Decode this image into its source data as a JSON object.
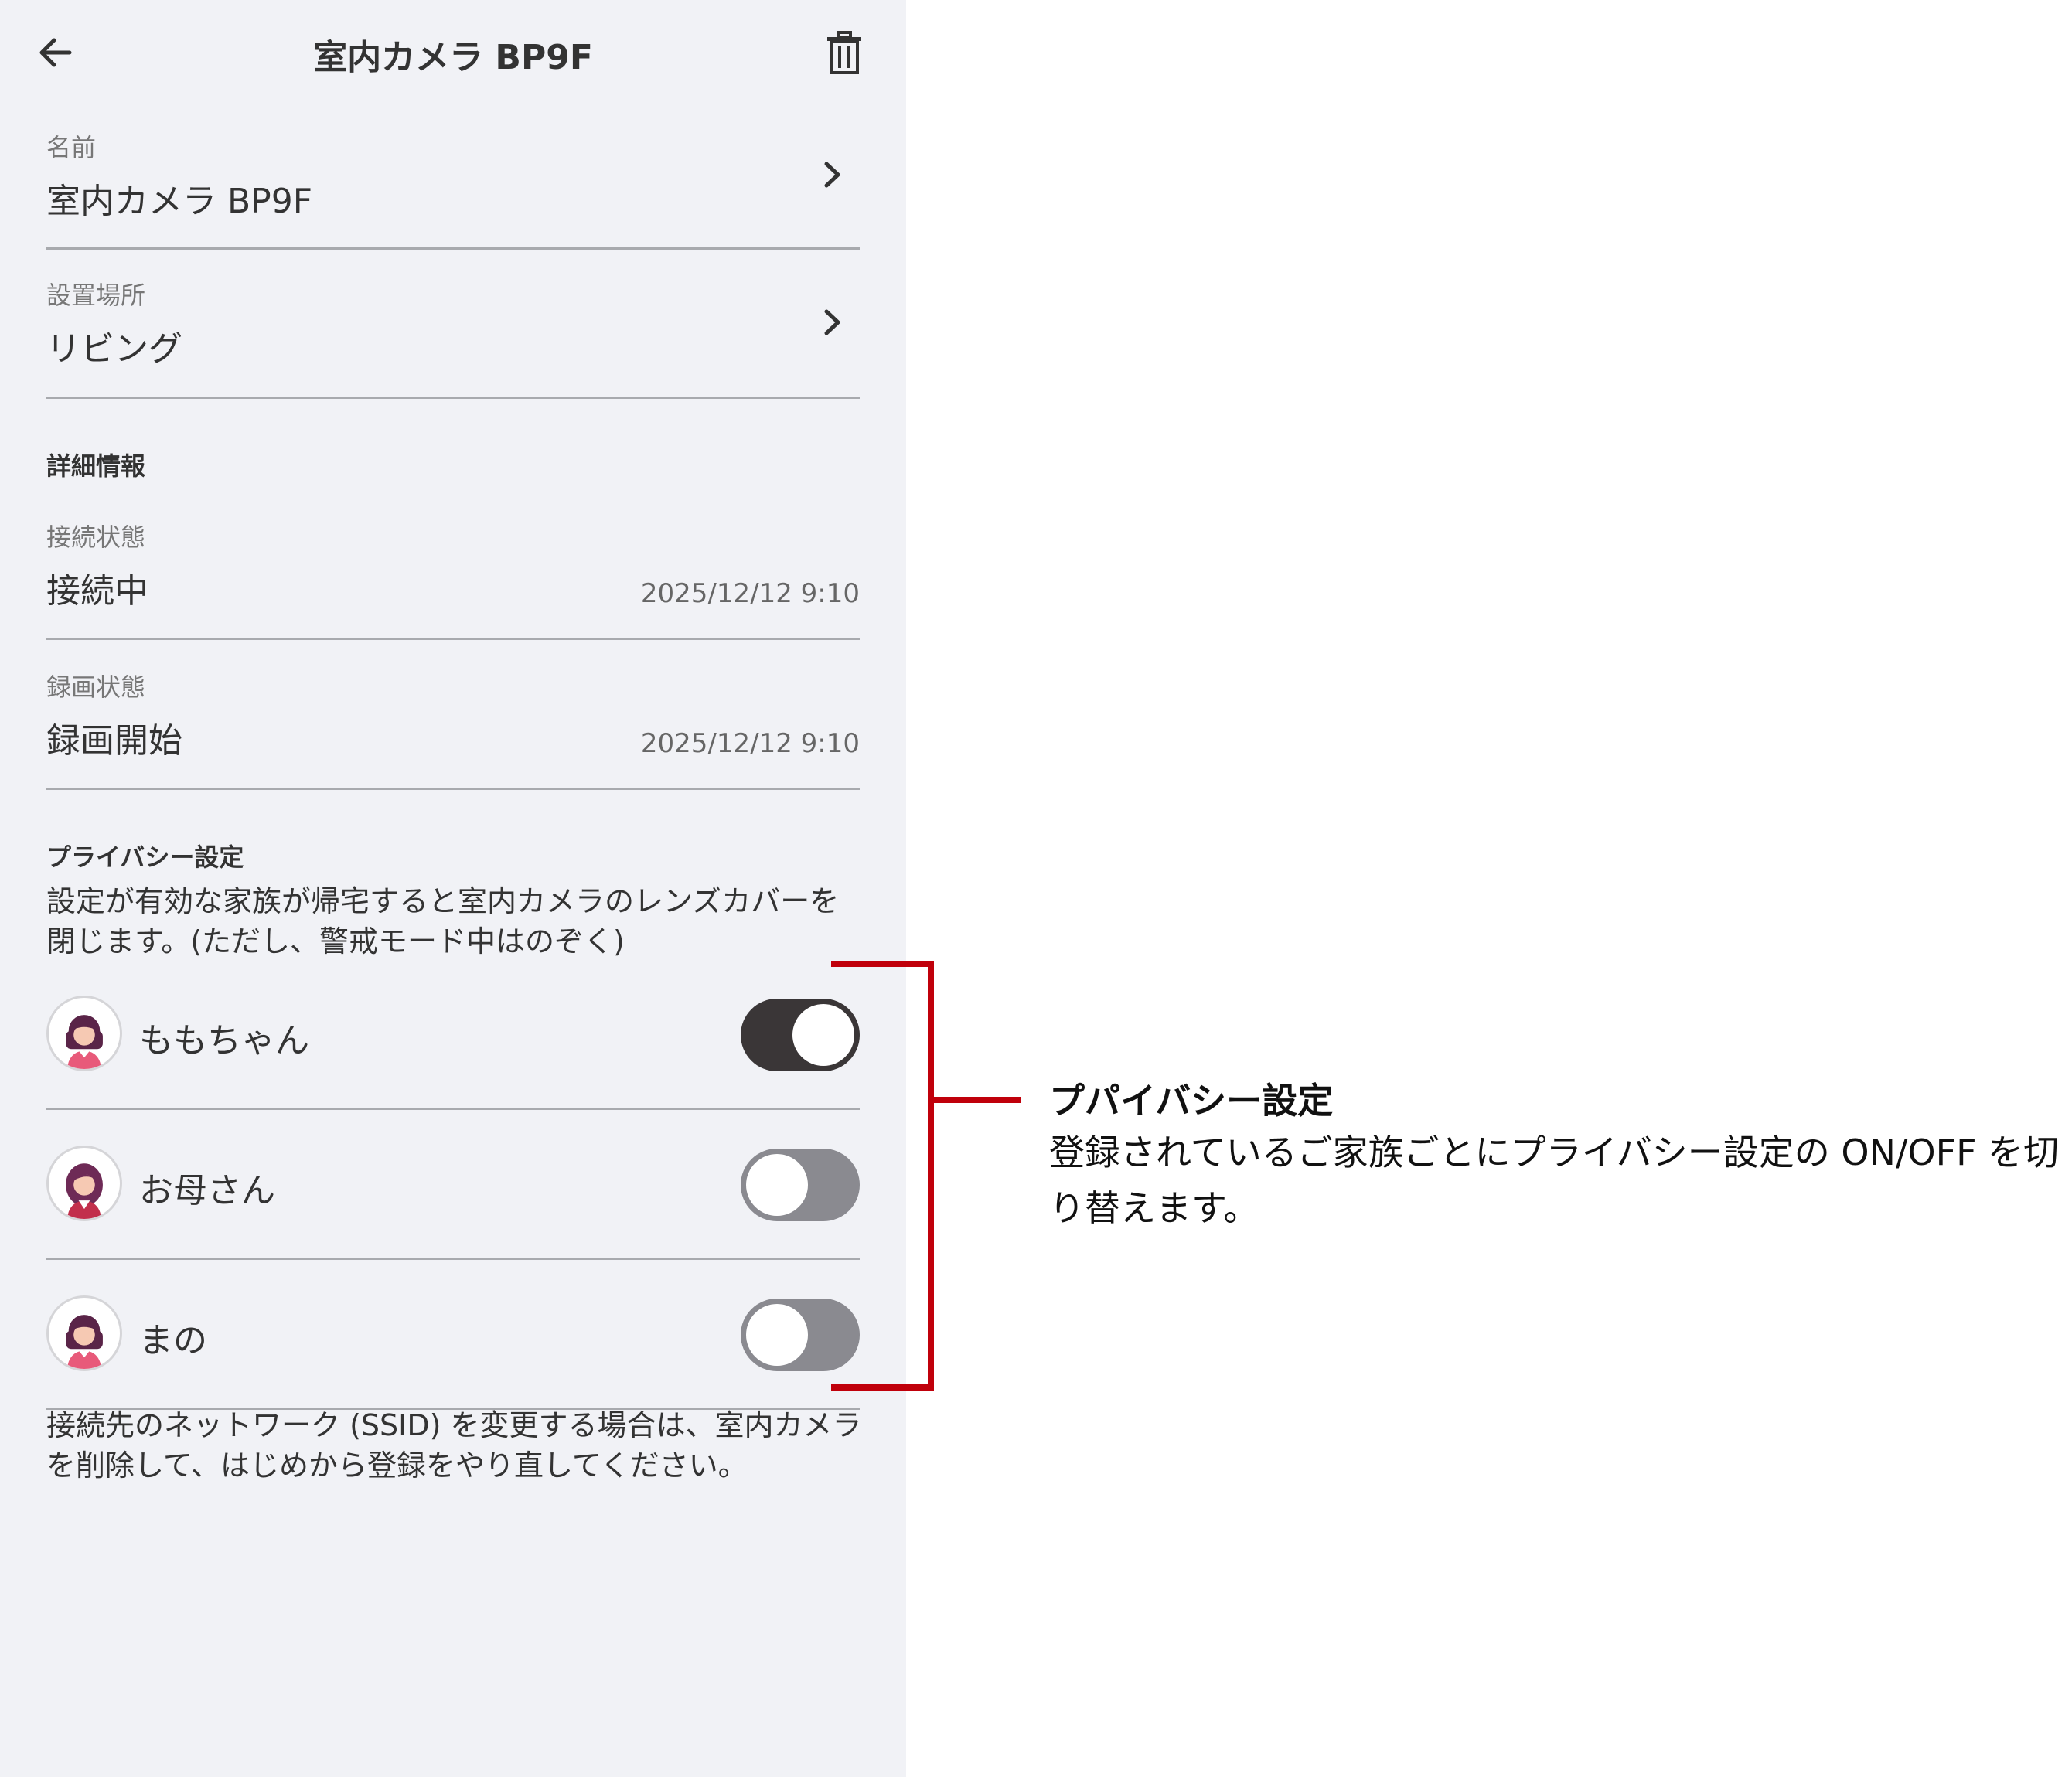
{
  "header": {
    "title": "室内カメラ BP9F",
    "back_icon": "arrow-left-icon",
    "delete_icon": "trash-icon"
  },
  "name_row": {
    "label": "名前",
    "value": "室内カメラ BP9F"
  },
  "location_row": {
    "label": "設置場所",
    "value": "リビング"
  },
  "details": {
    "title": "詳細情報",
    "connection": {
      "label": "接続状態",
      "value": "接続中",
      "timestamp": "2025/12/12 9:10"
    },
    "recording": {
      "label": "録画状態",
      "value": "録画開始",
      "timestamp": "2025/12/12 9:10"
    }
  },
  "privacy": {
    "title": "プライバシー設定",
    "description": "設定が有効な家族が帰宅すると室内カメラのレンズカバーを閉じます。(ただし、警戒モード中はのぞく)",
    "members": [
      {
        "name": "ももちゃん",
        "enabled": true
      },
      {
        "name": "お母さん",
        "enabled": false
      },
      {
        "name": "まの",
        "enabled": false
      }
    ]
  },
  "footer_note": "接続先のネットワーク (SSID) を変更する場合は、室内カメラを削除して、はじめから登録をやり直してください。",
  "annotation": {
    "title": "プパイバシー設定",
    "text": "登録されているご家族ごとにプライバシー設定の ON/OFF を切り替えます。"
  },
  "colors": {
    "screen_bg": "#f1f2f6",
    "toggle_on": "#3a3637",
    "toggle_off": "#8a8a90",
    "annotation_red": "#c0000b"
  }
}
